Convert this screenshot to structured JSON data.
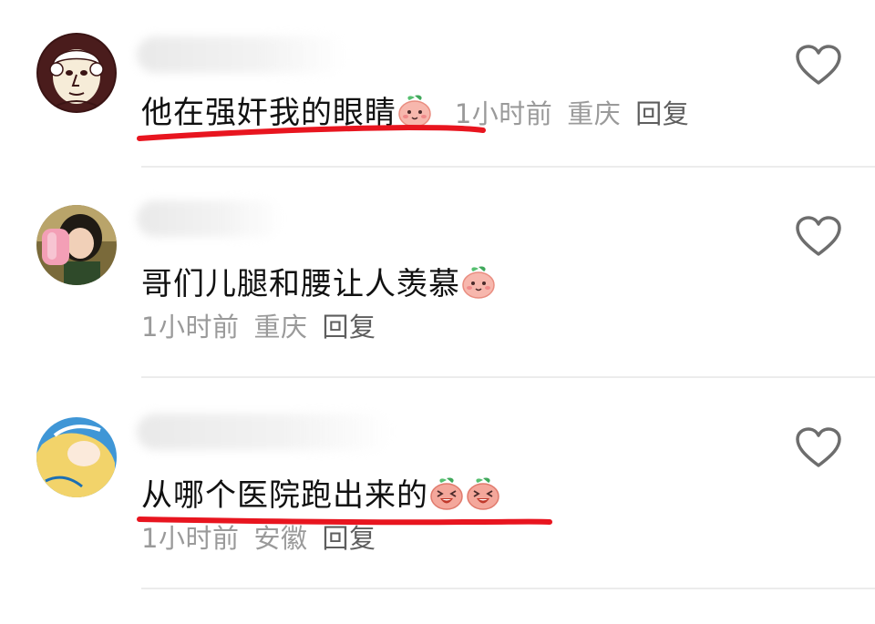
{
  "comments": [
    {
      "text": "他在强奸我的眼睛",
      "time": "1小时前",
      "location": "重庆",
      "reply_label": "回复",
      "emoji": "smile-peach-icon"
    },
    {
      "text": "哥们儿腿和腰让人羡慕",
      "time": "1小时前",
      "location": "重庆",
      "reply_label": "回复",
      "emoji": "smile-peach-icon"
    },
    {
      "text": "从哪个医院跑出来的",
      "time": "1小时前",
      "location": "安徽",
      "reply_label": "回复",
      "emoji": "laugh-peach-icon"
    }
  ],
  "colors": {
    "underline": "#e8151f",
    "meta": "#9a9a9a",
    "divider": "#ececec"
  }
}
